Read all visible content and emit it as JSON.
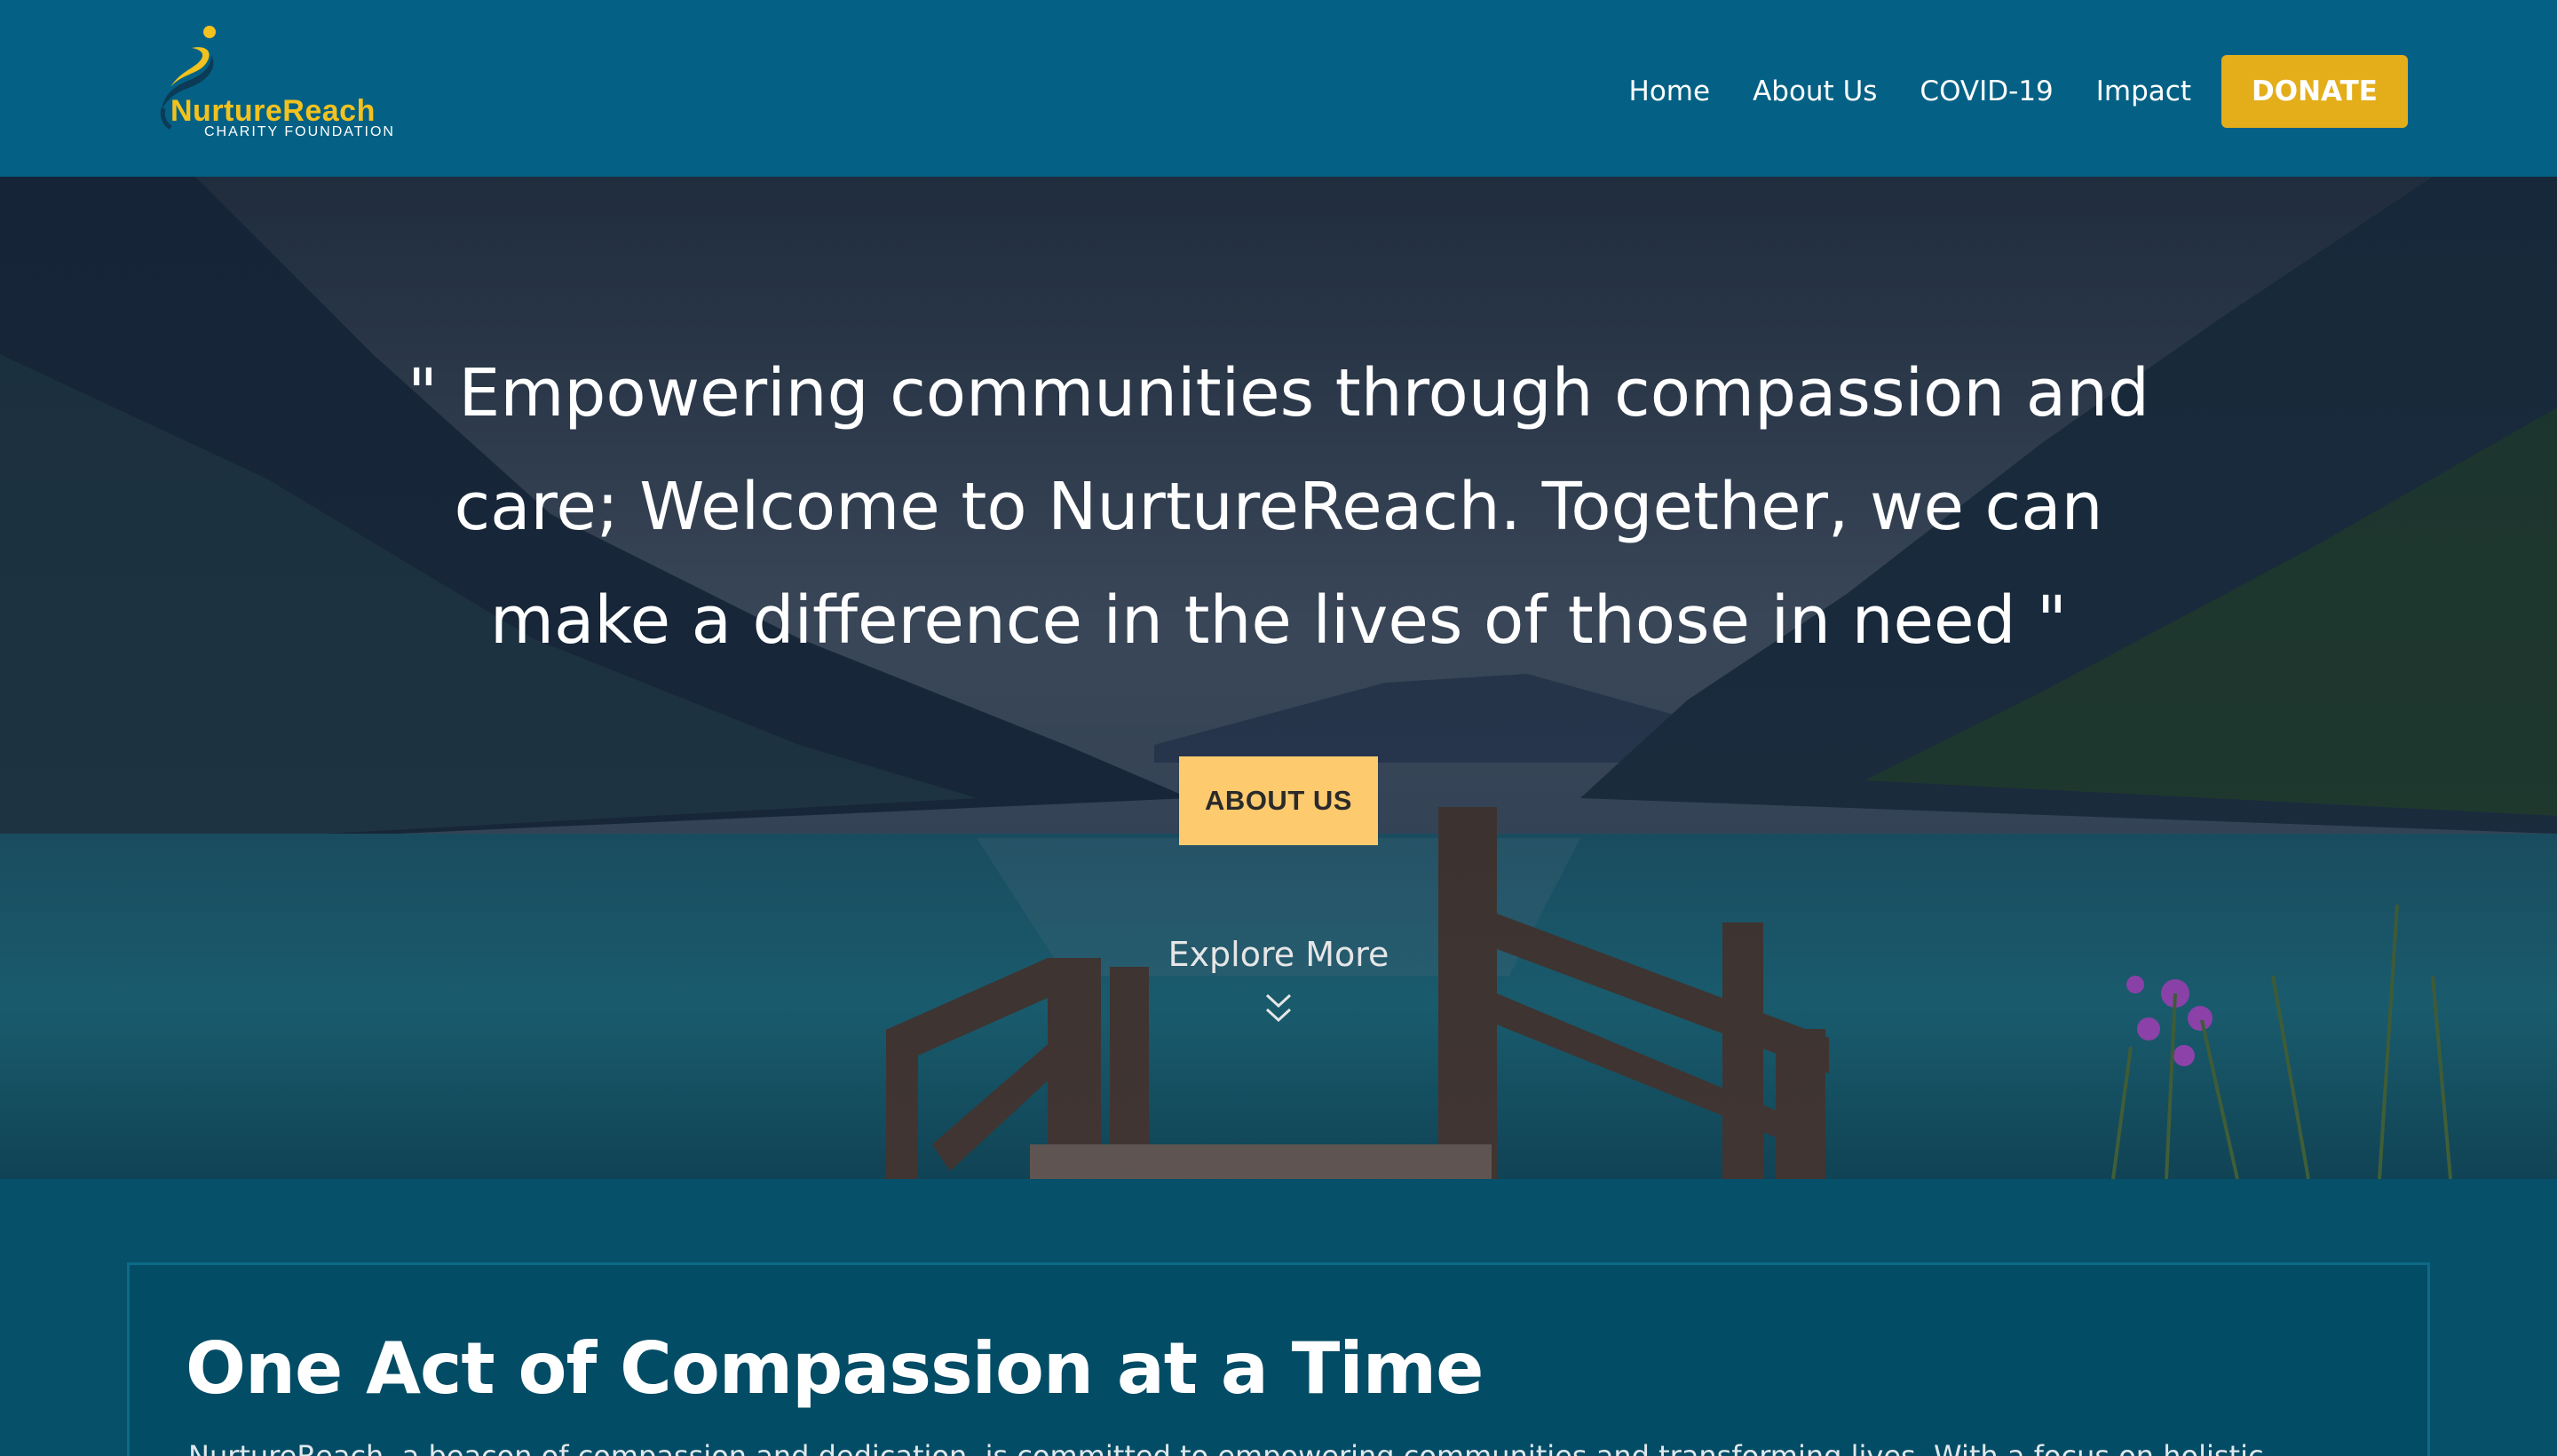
{
  "brand": {
    "name": "NurtureReach",
    "tagline": "CHARITY FOUNDATION",
    "primary_color": "#046185",
    "accent_color": "#e3ae1a",
    "name_color": "#f3c21e"
  },
  "nav": {
    "items": [
      {
        "label": "Home"
      },
      {
        "label": "About Us"
      },
      {
        "label": "COVID-19"
      },
      {
        "label": "Impact"
      }
    ],
    "donate_label": "DONATE"
  },
  "hero": {
    "quote": "\" Empowering communities through compassion and care; Welcome to NurtureReach. Together, we can make a difference in the lives of those in need \"",
    "button_label": "ABOUT US",
    "button_color": "#fdca6e",
    "explore_label": "Explore More",
    "explore_icon": "double-chevron-down-icon"
  },
  "section": {
    "title": "One Act of Compassion at a Time",
    "text": "NurtureReach, a beacon of compassion and dedication, is committed to empowering communities and transforming lives. With a focus on holistic"
  }
}
